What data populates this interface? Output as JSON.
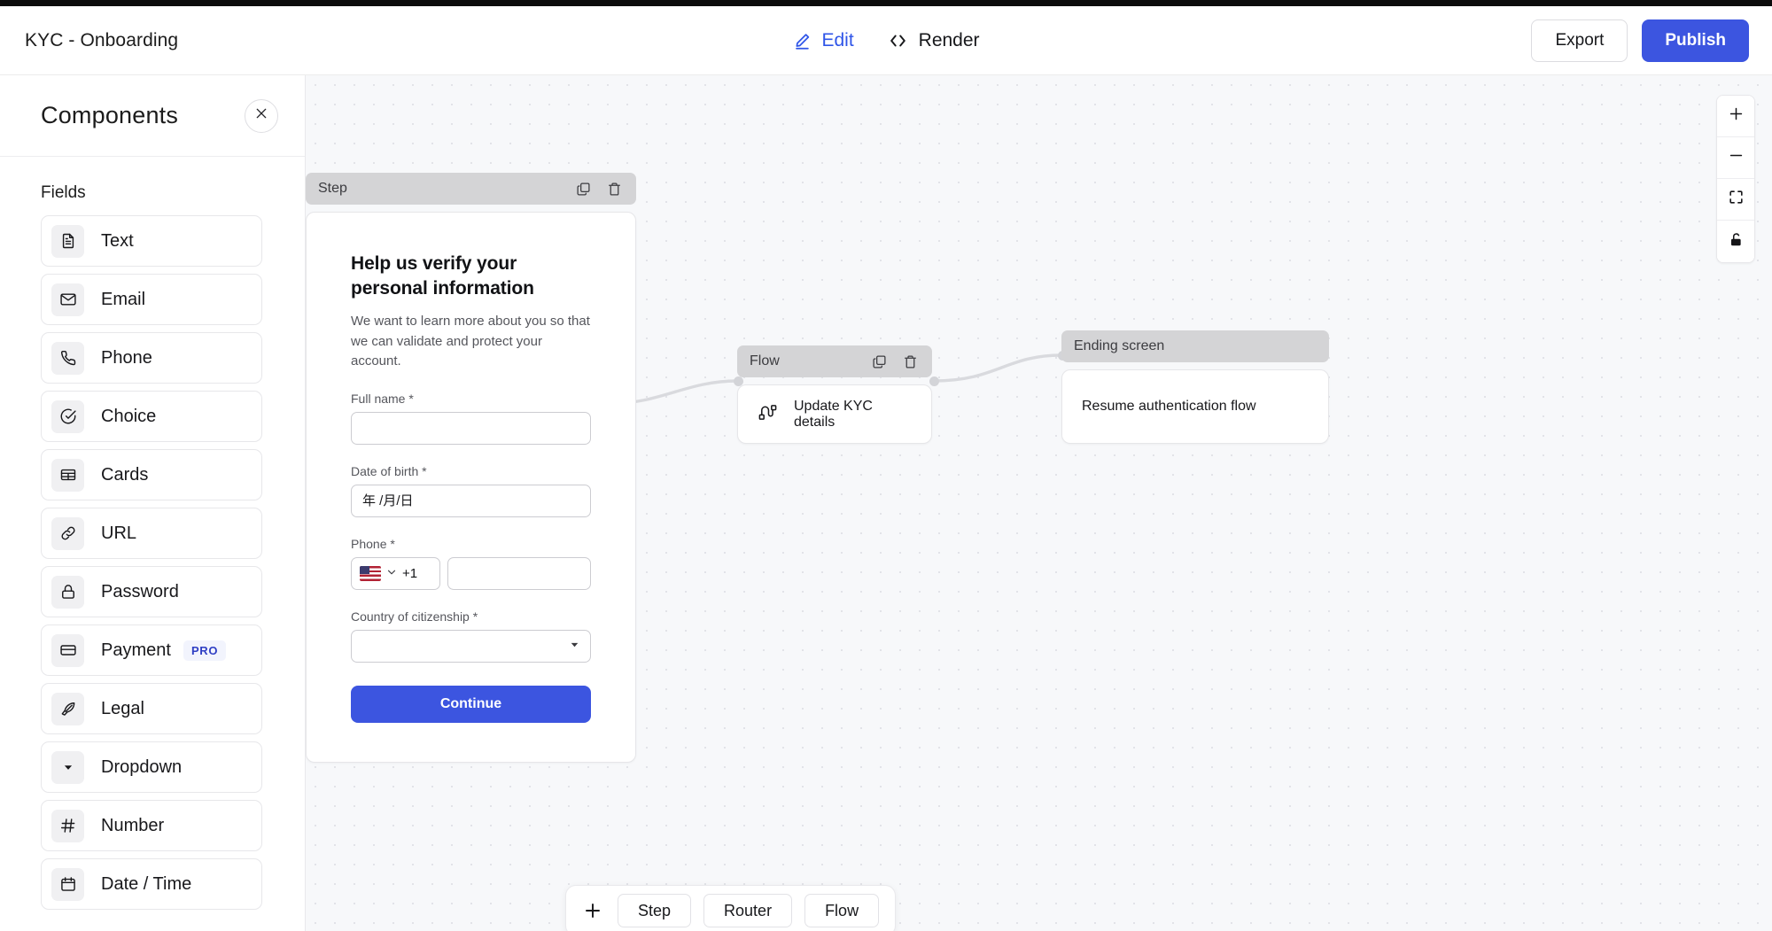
{
  "header": {
    "app_title": "KYC - Onboarding",
    "tabs": [
      {
        "label": "Edit",
        "icon": "pencil-icon",
        "active": true
      },
      {
        "label": "Render",
        "icon": "code-brackets-icon",
        "active": false
      }
    ],
    "export_label": "Export",
    "publish_label": "Publish",
    "accent_color": "#3c55e0"
  },
  "sidebar": {
    "title": "Components",
    "close_icon": "close-icon",
    "section_label": "Fields",
    "items": [
      {
        "label": "Text",
        "icon": "document-icon"
      },
      {
        "label": "Email",
        "icon": "envelope-icon"
      },
      {
        "label": "Phone",
        "icon": "phone-icon"
      },
      {
        "label": "Choice",
        "icon": "check-circle-icon"
      },
      {
        "label": "Cards",
        "icon": "table-icon"
      },
      {
        "label": "URL",
        "icon": "link-icon"
      },
      {
        "label": "Password",
        "icon": "lock-icon"
      },
      {
        "label": "Payment",
        "icon": "credit-card-icon",
        "badge": "PRO"
      },
      {
        "label": "Legal",
        "icon": "feather-icon"
      },
      {
        "label": "Dropdown",
        "icon": "triangle-down-icon"
      },
      {
        "label": "Number",
        "icon": "hash-icon"
      },
      {
        "label": "Date / Time",
        "icon": "calendar-icon"
      }
    ]
  },
  "canvas": {
    "step_node": {
      "header_label": "Step",
      "duplicate_icon": "copy-icon",
      "delete_icon": "trash-icon",
      "form": {
        "title": "Help us verify your personal information",
        "subtitle": "We want to learn more about you so that we can validate and protect your account.",
        "fields": [
          {
            "label": "Full name *",
            "value": "",
            "placeholder": ""
          },
          {
            "label": "Date of birth *",
            "value": "",
            "placeholder": "年 /月/日"
          },
          {
            "label": "Phone *",
            "value": "",
            "placeholder": "",
            "country_code": "+1",
            "flag": "us-flag-icon"
          },
          {
            "label": "Country of citizenship *",
            "value": "",
            "placeholder": ""
          }
        ],
        "submit_label": "Continue"
      }
    },
    "flow_node": {
      "header_label": "Flow",
      "duplicate_icon": "copy-icon",
      "delete_icon": "trash-icon",
      "item_label": "Update KYC details",
      "item_icon": "workflow-icon"
    },
    "ending_node": {
      "header_label": "Ending screen",
      "item_label": "Resume authentication flow"
    }
  },
  "zoom_controls": [
    {
      "name": "zoom-in",
      "icon": "plus-icon"
    },
    {
      "name": "zoom-out",
      "icon": "minus-icon"
    },
    {
      "name": "fit-view",
      "icon": "fit-screen-icon"
    },
    {
      "name": "lock-canvas",
      "icon": "unlock-icon"
    }
  ],
  "bottom_toolbar": {
    "add_icon": "plus-icon",
    "buttons": [
      {
        "label": "Step"
      },
      {
        "label": "Router"
      },
      {
        "label": "Flow"
      }
    ]
  }
}
